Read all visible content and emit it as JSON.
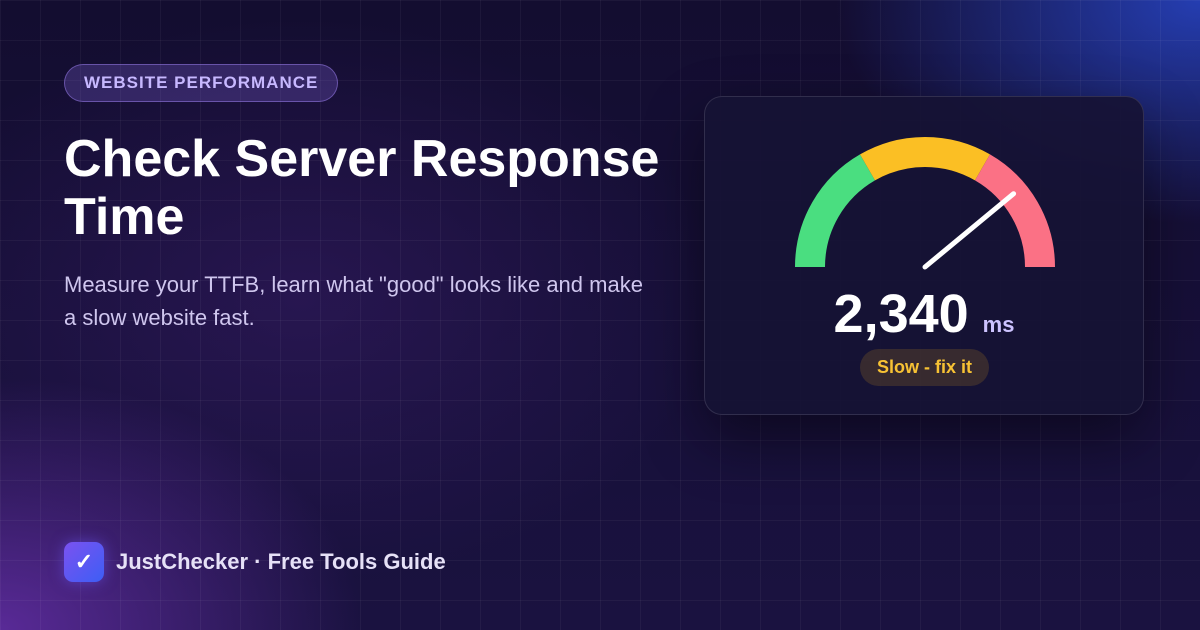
{
  "badge": {
    "label": "WEBSITE PERFORMANCE"
  },
  "hero": {
    "title": "Check Server Response Time",
    "subtitle": "Measure your TTFB, learn what \"good\" looks like and make a slow website fast."
  },
  "brand": {
    "logo_icon": "check-icon",
    "logo_glyph": "✓",
    "name": "JustChecker · Free Tools Guide"
  },
  "gauge": {
    "value": "2,340",
    "unit": "ms",
    "status": "Slow - fix it",
    "needle_fraction": 0.78,
    "colors": {
      "good": "#4ade80",
      "medium": "#fbbf24",
      "bad": "#fb7185",
      "status": "#f7c234"
    }
  }
}
